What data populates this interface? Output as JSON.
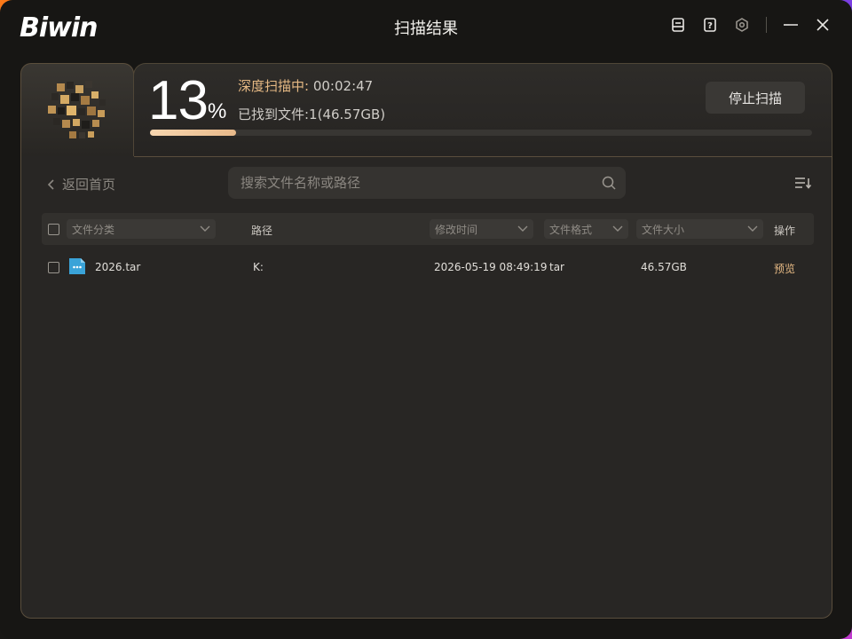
{
  "app": {
    "logo": "Biwin",
    "title": "扫描结果"
  },
  "titlebar": {
    "icons": [
      "feedback-icon",
      "help-icon",
      "settings-icon"
    ],
    "minimize": "minimize-icon",
    "close": "close-icon"
  },
  "scan": {
    "percent": "13",
    "percent_sign": "%",
    "progress": 0.13,
    "status_label": "深度扫描中:",
    "elapsed": "00:02:47",
    "found_text": "已找到文件:1(46.57GB)",
    "stop_button": "停止扫描"
  },
  "nav": {
    "back_label": "返回首页"
  },
  "search": {
    "placeholder": "搜索文件名称或路径"
  },
  "table": {
    "headers": {
      "category": "文件分类",
      "path": "路径",
      "modified": "修改时间",
      "format": "文件格式",
      "size": "文件大小",
      "action": "操作"
    },
    "rows": [
      {
        "name": "2026.tar",
        "path": "K:",
        "modified": "2026-05-19 08:49:19",
        "format": "tar",
        "size": "46.57GB",
        "action": "预览"
      }
    ]
  },
  "colors": {
    "accent": "#e6b984",
    "background": "#171614",
    "panel": "#282624"
  }
}
